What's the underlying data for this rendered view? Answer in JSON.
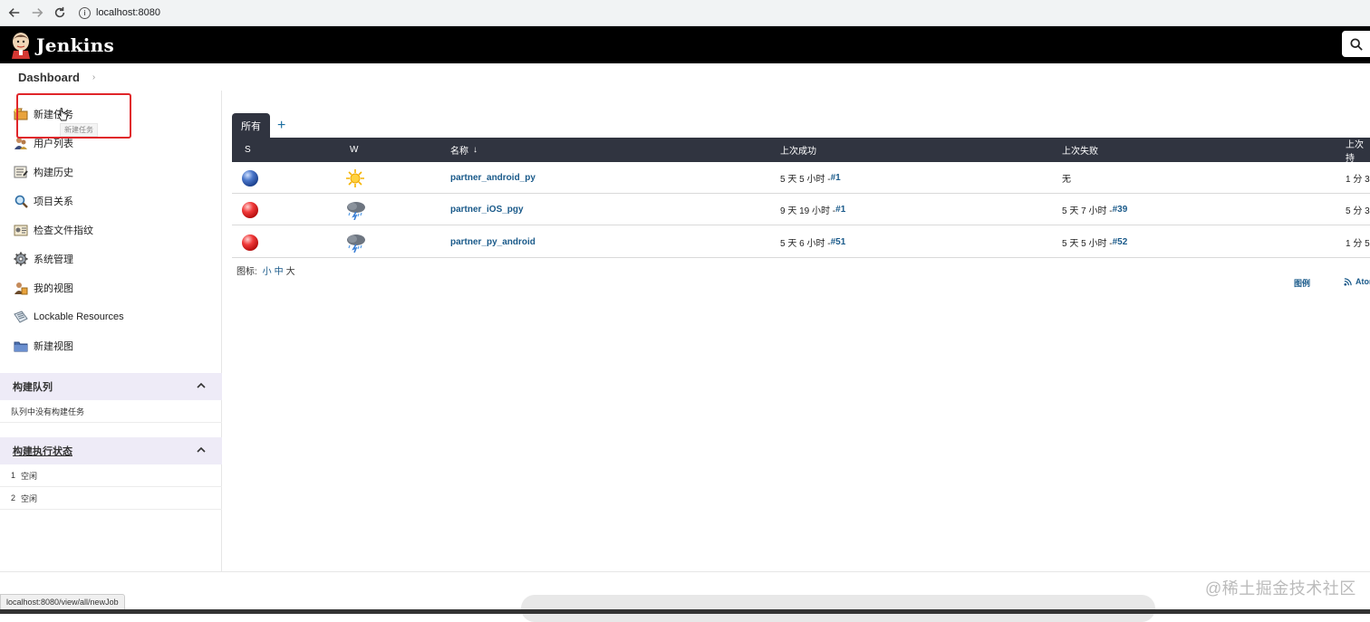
{
  "browser": {
    "url": "localhost:8080"
  },
  "header": {
    "title": "Jenkins"
  },
  "breadcrumb": {
    "item": "Dashboard",
    "separator": "›"
  },
  "sidebar": {
    "tasks": [
      {
        "label": "新建任务",
        "icon": "new-item-icon"
      },
      {
        "label": "用户列表",
        "icon": "users-icon"
      },
      {
        "label": "构建历史",
        "icon": "build-history-icon"
      },
      {
        "label": "项目关系",
        "icon": "magnifier-icon"
      },
      {
        "label": "检查文件指纹",
        "icon": "fingerprint-icon"
      },
      {
        "label": "系统管理",
        "icon": "gear-icon"
      },
      {
        "label": "我的视图",
        "icon": "my-views-icon"
      },
      {
        "label": "Lockable Resources",
        "icon": "lockable-resources-icon"
      },
      {
        "label": "新建视图",
        "icon": "folder-icon"
      }
    ],
    "tooltip": "新建任务",
    "build_queue": {
      "title": "构建队列",
      "empty_text": "队列中没有构建任务"
    },
    "executors": {
      "title": "构建执行状态",
      "rows": [
        {
          "num": "1",
          "status": "空闲"
        },
        {
          "num": "2",
          "status": "空闲"
        }
      ]
    }
  },
  "main": {
    "tabs": {
      "active": "所有",
      "add": "+"
    },
    "table": {
      "columns": {
        "s": "S",
        "w": "W",
        "name": "名称",
        "sort": "↓",
        "last_success": "上次成功",
        "last_failure": "上次失败",
        "last_duration": "上次持"
      },
      "rows": [
        {
          "status": "blue",
          "weather": "sunny",
          "name": "partner_android_py",
          "success_text": "5 天 5 小时 - ",
          "success_build": "#1",
          "failure_text": "无",
          "failure_build": "",
          "duration": "1 分 3"
        },
        {
          "status": "red",
          "weather": "storm",
          "name": "partner_iOS_pgy",
          "success_text": "9 天 19 小时 - ",
          "success_build": "#1",
          "failure_text": "5 天 7 小时 - ",
          "failure_build": "#39",
          "duration": "5 分 3"
        },
        {
          "status": "red",
          "weather": "storm",
          "name": "partner_py_android",
          "success_text": "5 天 6 小时 - ",
          "success_build": "#51",
          "failure_text": "5 天 5 小时 - ",
          "failure_build": "#52",
          "duration": "1 分 5"
        }
      ]
    },
    "icon_size": {
      "label": "图标: ",
      "small": "小",
      "medium": "中",
      "large": "大"
    },
    "legend": "图例",
    "atom": "Atom"
  },
  "status_bar": {
    "url": "localhost:8080/view/all/newJob"
  },
  "watermark": "@稀土掘金技术社区"
}
